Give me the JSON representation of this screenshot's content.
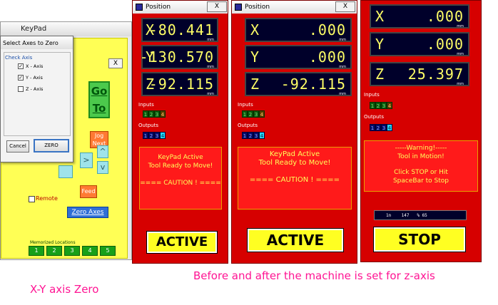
{
  "keypad": {
    "title": "KeyPad",
    "close_label": "X",
    "go_label": "Go To",
    "jog_label": "Jog Next",
    "arrows": {
      "right": ">",
      "up": "^",
      "down": "v"
    },
    "feed_label": "Feed",
    "remote_label": "Remote",
    "zero_axes_label": "Zero Axes",
    "memorized_label": "Memorized Locations",
    "memorized": [
      "1",
      "2",
      "3",
      "4",
      "5"
    ]
  },
  "dialog": {
    "title": "Select Axes to Zero",
    "group_label": "Check Axis",
    "options": [
      {
        "label": "X - Axis",
        "checked": true
      },
      {
        "label": "Y - Axis",
        "checked": true
      },
      {
        "label": "Z - Axis",
        "checked": false
      }
    ],
    "cancel_label": "Cancel",
    "zero_label": "ZERO"
  },
  "windows": [
    {
      "title": "Position",
      "close_label": "X",
      "axes": [
        {
          "axis": "X",
          "value": "-80.441",
          "unit": "mm"
        },
        {
          "axis": "Y",
          "value": "-130.570",
          "unit": "mm"
        },
        {
          "axis": "Z",
          "value": "-92.115",
          "unit": "mm"
        }
      ],
      "inputs_label": "Inputs",
      "inputs": [
        "1",
        "2",
        "3",
        "4"
      ],
      "outputs_label": "Outputs",
      "outputs": [
        "1",
        "2",
        "3",
        "4"
      ],
      "message": [
        "KeyPad Active",
        "Tool Ready to Move!",
        "",
        "==== CAUTION ! ===="
      ],
      "status_button": "ACTIVE"
    },
    {
      "title": "Position",
      "close_label": "X",
      "axes": [
        {
          "axis": "X",
          "value": ".000",
          "unit": "mm"
        },
        {
          "axis": "Y",
          "value": ".000",
          "unit": "mm"
        },
        {
          "axis": "Z",
          "value": "-92.115",
          "unit": "mm"
        }
      ],
      "inputs_label": "Inputs",
      "inputs": [
        "1",
        "2",
        "3",
        "4"
      ],
      "outputs_label": "Outputs",
      "outputs": [
        "1",
        "2",
        "3",
        "4"
      ],
      "message": [
        "KeyPad Active",
        "Tool Ready to Move!",
        "",
        "==== CAUTION ! ===="
      ],
      "status_button": "ACTIVE"
    },
    {
      "axes": [
        {
          "axis": "X",
          "value": ".000",
          "unit": "mm"
        },
        {
          "axis": "Y",
          "value": ".000",
          "unit": "mm"
        },
        {
          "axis": "Z",
          "value": "25.397",
          "unit": "mm"
        }
      ],
      "inputs_label": "Inputs",
      "inputs": [
        "1",
        "2",
        "3",
        "4"
      ],
      "outputs_label": "Outputs",
      "outputs": [
        "1",
        "2",
        "3",
        "4"
      ],
      "message": [
        "-----Warning!-----",
        "Tool in Motion!",
        "",
        "Click STOP or Hit",
        "SpaceBar to Stop"
      ],
      "status_line": "1n    147   % 65",
      "status_button": "STOP"
    }
  ],
  "captions": {
    "left": "X-Y axis Zero",
    "right": "Before and after the machine is set for z-axis"
  },
  "colors": {
    "window_red": "#d60000",
    "display_bg": "#00002a",
    "digit_yellow": "#ffff66",
    "status_yellow": "#ffff22",
    "caption_pink": "#ff1493"
  }
}
